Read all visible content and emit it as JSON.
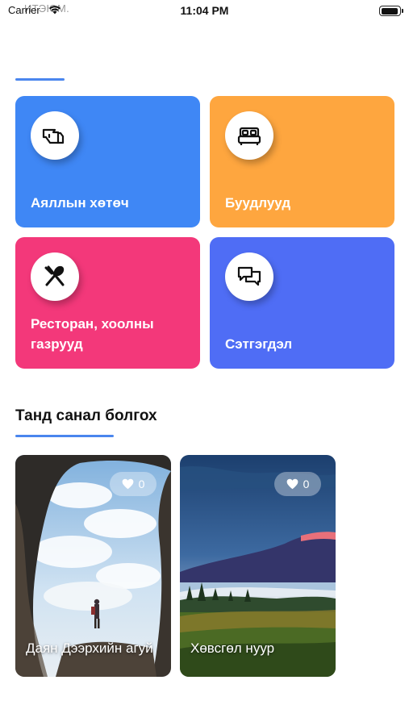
{
  "status_bar": {
    "carrier": "Carrier",
    "carrier_ghost": "ИТЭЮМ.",
    "time": "11:04 PM"
  },
  "categories": [
    {
      "label": "Аяллын хөтөч",
      "icon": "hand-pointing-icon",
      "color": "#3f87f5"
    },
    {
      "label": "Буудлууд",
      "icon": "bed-icon",
      "color": "#fea63f"
    },
    {
      "label": "Ресторан, хоолны газрууд",
      "icon": "fork-spoon-icon",
      "color": "#f3387a"
    },
    {
      "label": "Сэтгэгдэл",
      "icon": "chat-bubbles-icon",
      "color": "#4f6df5"
    }
  ],
  "recommendations": {
    "title": "Танд санал болгох",
    "items": [
      {
        "title": "Даян Дээрхийн агуй",
        "likes": "0"
      },
      {
        "title": "Хөвсгөл нуур",
        "likes": "0"
      }
    ]
  }
}
